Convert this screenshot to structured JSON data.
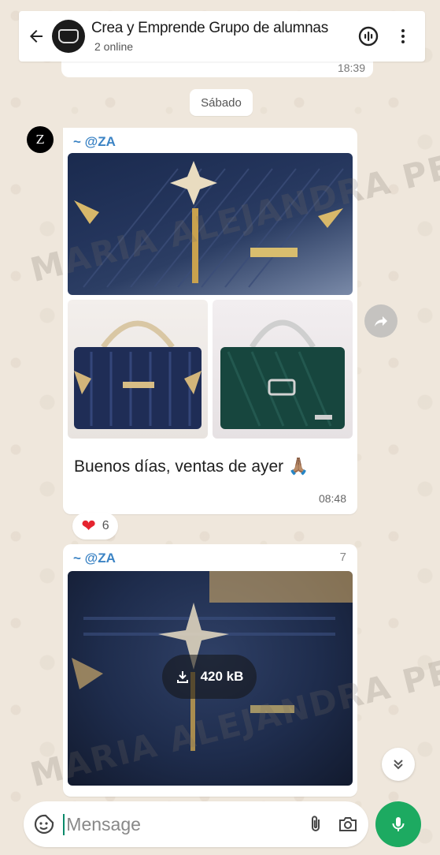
{
  "header": {
    "title": "Crea y Emprende Grupo de alumnas",
    "subtitle": "2 online"
  },
  "previous_message": {
    "time": "18:39"
  },
  "date_divider": "Sábado",
  "messages": [
    {
      "sender": "~ @ZA",
      "sender_phone": "",
      "text": "Buenos días, ventas de ayer 🙏🏽",
      "time": "08:48",
      "reaction": {
        "emoji": "❤",
        "count": "6"
      }
    },
    {
      "sender": "~ @ZA",
      "sender_phone": "7",
      "media_size": "420 kB"
    }
  ],
  "sender_avatar_letter": "Z",
  "composer": {
    "placeholder": "Mensage"
  },
  "watermark": "MARIA ALEJANDRA PEARS",
  "colors": {
    "accent_green": "#1daa61",
    "sender_name": "#3b83c4",
    "background": "#efe7dc"
  }
}
